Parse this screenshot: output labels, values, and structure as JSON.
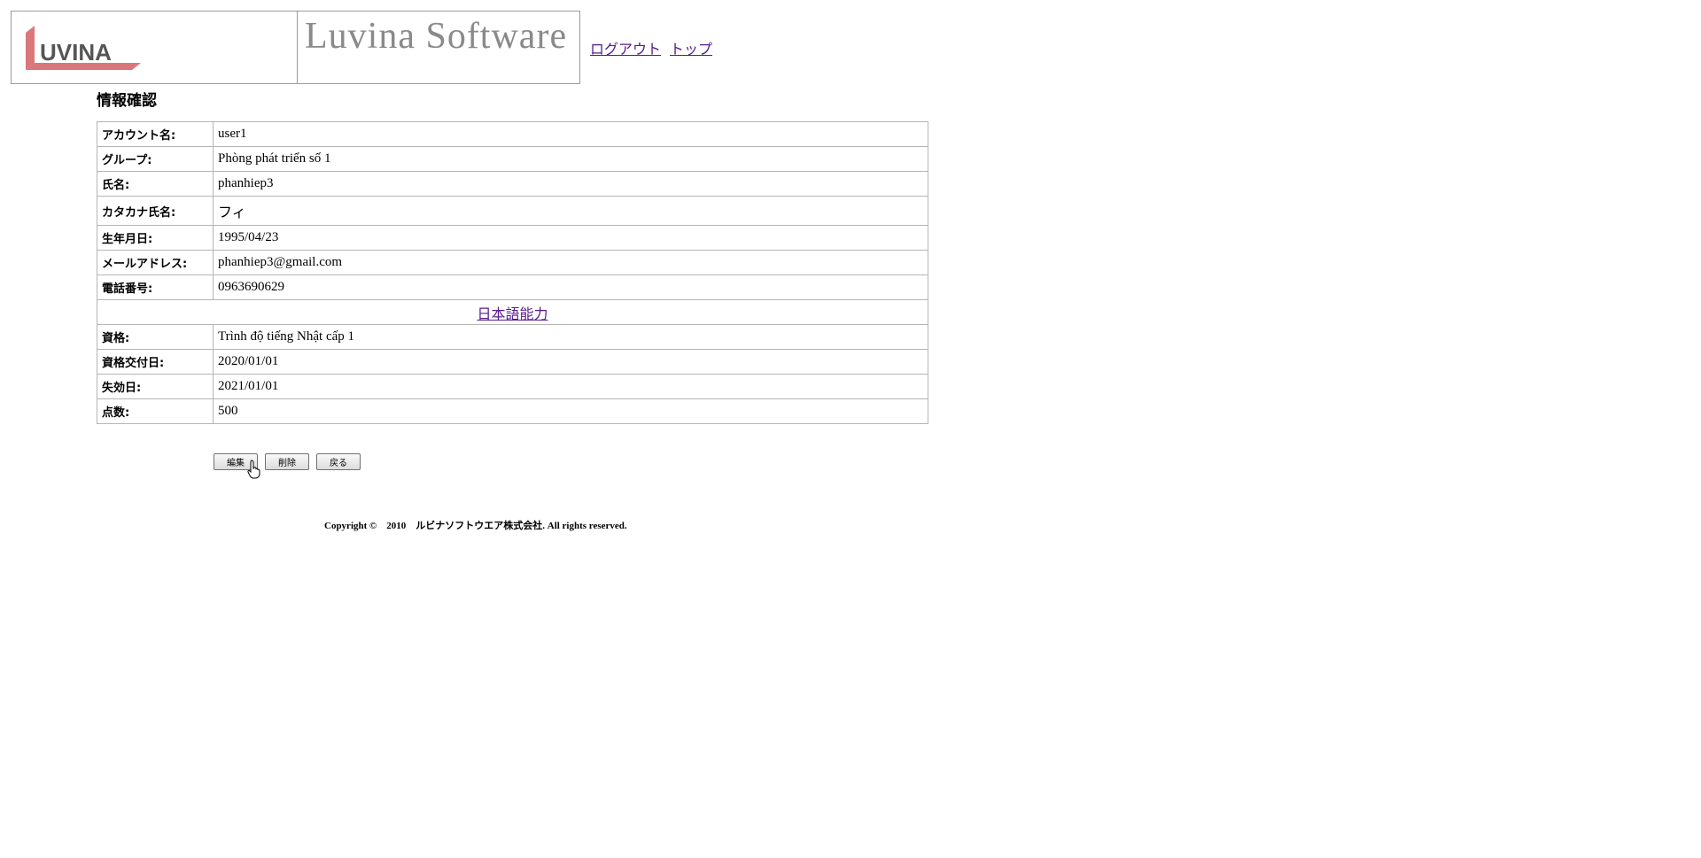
{
  "header": {
    "logo_text": "UVINA",
    "brand_title": "Luvina Software",
    "nav": {
      "logout": "ログアウト",
      "top": "トップ"
    }
  },
  "section_title": "情報確認",
  "info_rows": [
    {
      "label": "アカウント名:",
      "value": "user1"
    },
    {
      "label": "グループ:",
      "value": "Phòng phát triển số 1"
    },
    {
      "label": "氏名:",
      "value": "phanhiep3"
    },
    {
      "label": "カタカナ氏名:",
      "value": "フィ"
    },
    {
      "label": "生年月日:",
      "value": "1995/04/23"
    },
    {
      "label": "メールアドレス:",
      "value": "phanhiep3@gmail.com"
    },
    {
      "label": "電話番号:",
      "value": "0963690629"
    }
  ],
  "japanese_section": {
    "title": "日本語能力",
    "rows": [
      {
        "label": "資格:",
        "value": "Trình độ tiếng Nhật cấp 1"
      },
      {
        "label": "資格交付日:",
        "value": "2020/01/01"
      },
      {
        "label": "失効日:",
        "value": "2021/01/01"
      },
      {
        "label": "点数:",
        "value": "500"
      }
    ]
  },
  "buttons": {
    "edit": "編集",
    "delete": "削除",
    "back": "戻る"
  },
  "footer": {
    "copyright": "Copyright ©　2010　ルビナソフトウエア株式会社. All rights reserved."
  },
  "colors": {
    "logo_red": "#d9777c",
    "link": "#551a8b",
    "border": "#b5b5b5"
  }
}
